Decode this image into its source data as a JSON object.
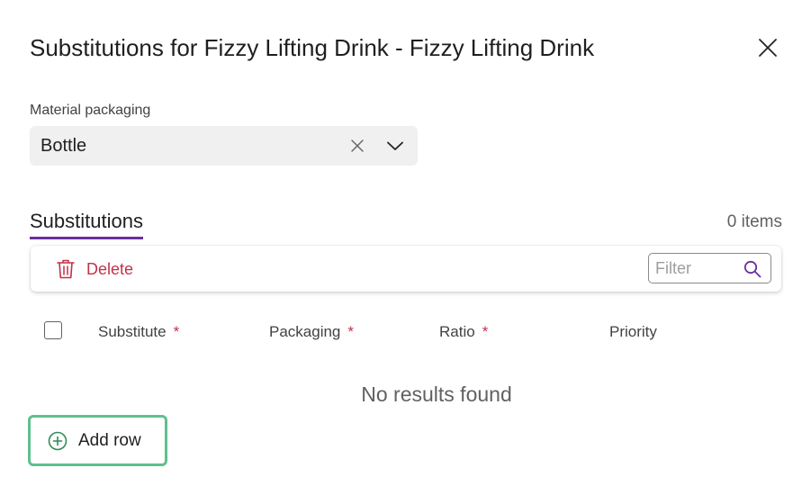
{
  "dialog": {
    "title": "Substitutions for Fizzy Lifting Drink - Fizzy Lifting Drink",
    "close_icon": "close-icon"
  },
  "material_packaging": {
    "label": "Material packaging",
    "value": "Bottle"
  },
  "tabs": [
    {
      "label": "Substitutions",
      "selected": true
    }
  ],
  "grid": {
    "item_count": "0 items",
    "toolbar": {
      "delete_label": "Delete",
      "delete_icon": "trash-icon",
      "filter_placeholder": "Filter",
      "filter_value": "",
      "filter_icon": "search-icon"
    },
    "columns": [
      {
        "label": "Substitute",
        "required": "*"
      },
      {
        "label": "Packaging",
        "required": "*"
      },
      {
        "label": "Ratio",
        "required": "*"
      },
      {
        "label": "Priority",
        "required": ""
      }
    ],
    "empty_message": "No results found",
    "add_row_label": "Add row",
    "add_row_icon": "add-circle-icon"
  },
  "colors": {
    "accent": "#6b2fa0",
    "danger": "#c4314b",
    "focus": "#5fc08e"
  }
}
